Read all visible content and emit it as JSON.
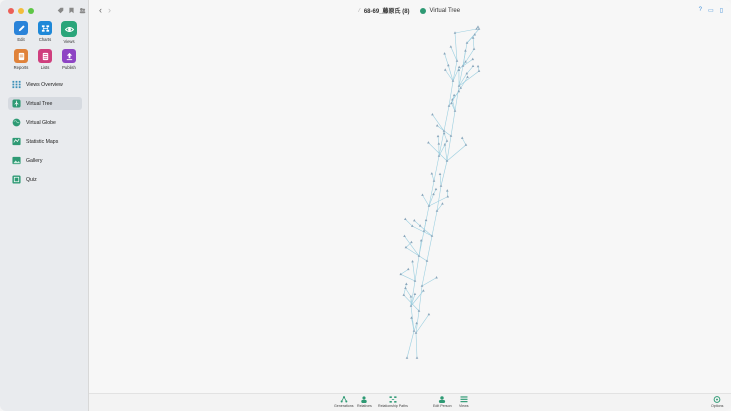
{
  "window": {
    "person_title": "68-69_藤原氏 (8)",
    "view_title": "Virtual Tree"
  },
  "apps": [
    {
      "label": "Edit",
      "color": "#2a83d9",
      "icon": "pencil-icon"
    },
    {
      "label": "Charts",
      "color": "#1e88d8",
      "icon": "charts-icon"
    },
    {
      "label": "Views",
      "color": "#2aa57a",
      "icon": "eye-icon",
      "active": true
    },
    {
      "label": "Reports",
      "color": "#e0823a",
      "icon": "reports-icon"
    },
    {
      "label": "Lists",
      "color": "#cf3f7e",
      "icon": "lists-icon"
    },
    {
      "label": "Publish",
      "color": "#8e44c4",
      "icon": "publish-icon"
    }
  ],
  "nav": [
    {
      "label": "Views Overview",
      "icon": "grid-icon"
    },
    {
      "label": "Virtual Tree",
      "icon": "virtual-tree-icon",
      "active": true
    },
    {
      "label": "Virtual Globe",
      "icon": "globe-icon"
    },
    {
      "label": "Statistic Maps",
      "icon": "map-icon"
    },
    {
      "label": "Gallery",
      "icon": "gallery-icon"
    },
    {
      "label": "Quiz",
      "icon": "quiz-icon"
    }
  ],
  "bottom": [
    {
      "label": "Generations",
      "icon": "generations-icon"
    },
    {
      "label": "Relatives",
      "icon": "relatives-icon"
    },
    {
      "label": "Relationship Paths",
      "icon": "relationship-paths-icon"
    },
    {
      "label": "Edit Person",
      "icon": "edit-person-icon"
    },
    {
      "label": "Views",
      "icon": "views-icon"
    },
    {
      "label": "Options",
      "icon": "options-icon"
    }
  ],
  "colors": {
    "accent": "#2e9a74",
    "tree_line": "#9ccfe0",
    "tree_node": "#8aa6bb"
  }
}
